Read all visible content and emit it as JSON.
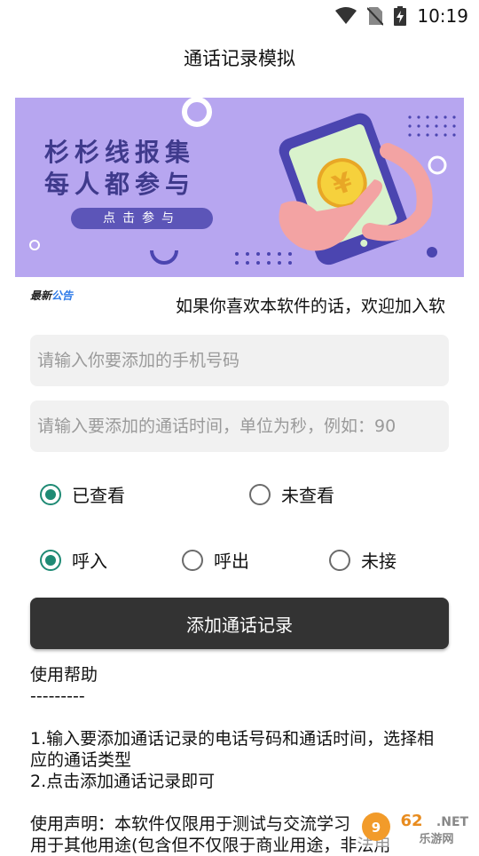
{
  "status_bar": {
    "time": "10:19"
  },
  "title": "通话记录模拟",
  "banner": {
    "line1": "杉杉线报集",
    "line2": "每人都参与",
    "button_label": "点击参与"
  },
  "notice": {
    "logo_prefix": "最新",
    "logo_suffix": "公告",
    "text": "如果你喜欢本软件的话，欢迎加入软"
  },
  "phone_field": {
    "placeholder": "请输入你要添加的手机号码",
    "value": ""
  },
  "duration_field": {
    "placeholder": "请输入要添加的通话时间，单位为秒，例如：90",
    "value": ""
  },
  "view_status": {
    "options": [
      "已查看",
      "未查看"
    ],
    "selected": "已查看"
  },
  "call_type": {
    "options": [
      "呼入",
      "呼出",
      "未接"
    ],
    "selected": "呼入"
  },
  "add_button_label": "添加通话记录",
  "help": {
    "title": "使用帮助",
    "divider": "---------",
    "line1": "1.输入要添加通话记录的电话号码和通话时间，选择相应的通话类型",
    "line2": "2.点击添加通话记录即可",
    "disclaimer_line1": "使用声明：本软件仅限用于测试与交流学习",
    "disclaimer_line2": "用于其他用途(包含但不仅限于商业用途，非法用"
  },
  "watermark": {
    "logo": "962",
    "site_cn": "乐游网"
  },
  "colors": {
    "accent": "#1e8a74",
    "button_bg": "#333333",
    "banner_bg": "#b7a6f0",
    "field_bg": "#f1f1f1"
  }
}
